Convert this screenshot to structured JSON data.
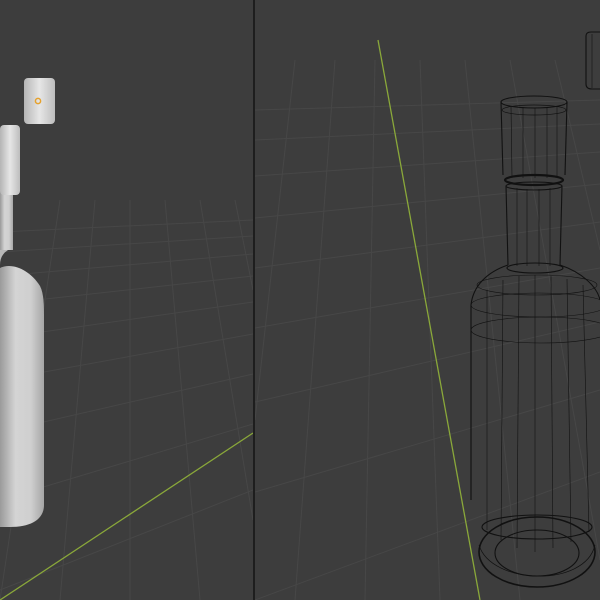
{
  "viewports": [
    {
      "id": "left",
      "shading": "solid",
      "grid": true,
      "objects": [
        "bottle",
        "cap"
      ],
      "origin_marker_color": "#e6a22e"
    },
    {
      "id": "right",
      "shading": "wireframe",
      "grid": true,
      "objects": [
        "bottle",
        "cap"
      ]
    }
  ],
  "colors": {
    "background": "#3d3d3d",
    "grid_line": "#4a4a4a",
    "x_axis": "#8aa83a",
    "y_axis": "#8aa83a",
    "solid_body": "#c9c9c9",
    "wire": "#111111",
    "divider": "#1e1e1e"
  }
}
